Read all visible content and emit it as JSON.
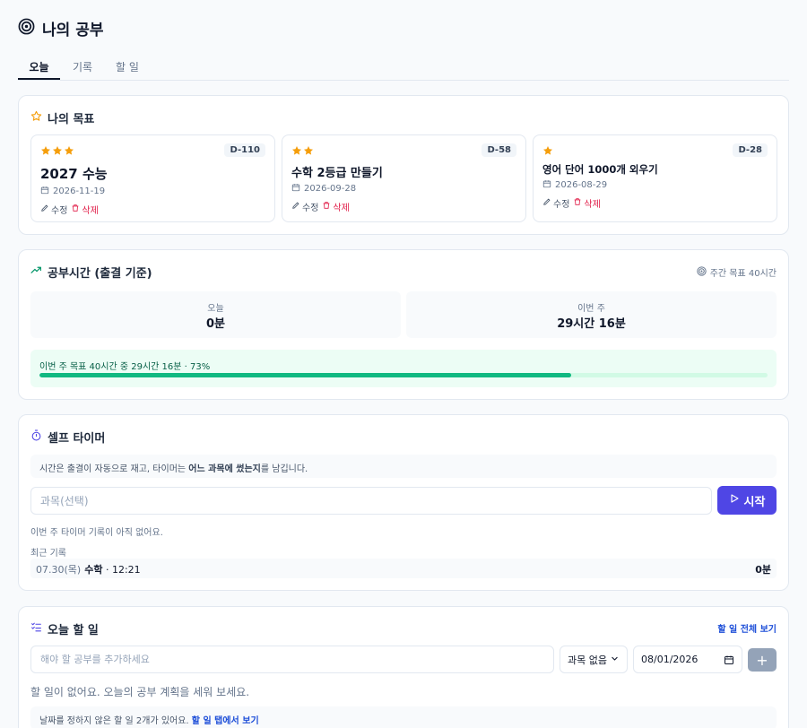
{
  "header": {
    "title": "나의 공부"
  },
  "tabs": [
    {
      "label": "오늘",
      "active": true
    },
    {
      "label": "기록"
    },
    {
      "label": "할 일"
    }
  ],
  "goals": {
    "title": "나의 목표",
    "edit_label": "수정",
    "delete_label": "삭제",
    "items": [
      {
        "stars": 3,
        "dday": "D-110",
        "name": "2027 수능",
        "date": "2026-11-19"
      },
      {
        "stars": 2,
        "dday": "D-58",
        "name": "수학 2등급 만들기",
        "date": "2026-09-28"
      },
      {
        "stars": 1,
        "dday": "D-28",
        "name": "영어 단어 1000개 외우기",
        "date": "2026-08-29"
      }
    ]
  },
  "study": {
    "title": "공부시간 (출결 기준)",
    "weekly_goal": "주간 목표 40시간",
    "today_label": "오늘",
    "today_value": "0분",
    "week_label": "이번 주",
    "week_value": "29시간 16분",
    "progress_text": "이번 주 목표 40시간 중 29시간 16분 · 73%",
    "progress_percent": 73
  },
  "timer": {
    "title": "셀프 타이머",
    "note_prefix": "시간은 출결이 자동으로 재고, 타이머는 ",
    "note_bold": "어느 과목에 썼는지",
    "note_suffix": "를 남깁니다.",
    "subject_placeholder": "과목(선택)",
    "start_label": "시작",
    "empty_week": "이번 주 타이머 기록이 아직 없어요.",
    "recent_label": "최근 기록",
    "recent": [
      {
        "date": "07.30(목)",
        "subject": "수학",
        "time": "· 12:21",
        "duration": "0분"
      }
    ]
  },
  "todo": {
    "title": "오늘 할 일",
    "see_all": "할 일 전체 보기",
    "input_placeholder": "해야 할 공부를 추가하세요",
    "subject_select": "과목 없음",
    "date_value": "08/01/2026",
    "add_symbol": "+",
    "empty_msg": "할 일이 없어요. 오늘의 공부 계획을 세워 보세요.",
    "undated_text": "날짜를 정하지 않은 할 일 2개가 있어요. ",
    "undated_link": "할 일 탭에서 보기"
  },
  "colors": {
    "accent": "#4f46e5",
    "star": "#f59e0b",
    "progress": "#10b981",
    "danger": "#e11d48",
    "link": "#1d4ed8"
  }
}
